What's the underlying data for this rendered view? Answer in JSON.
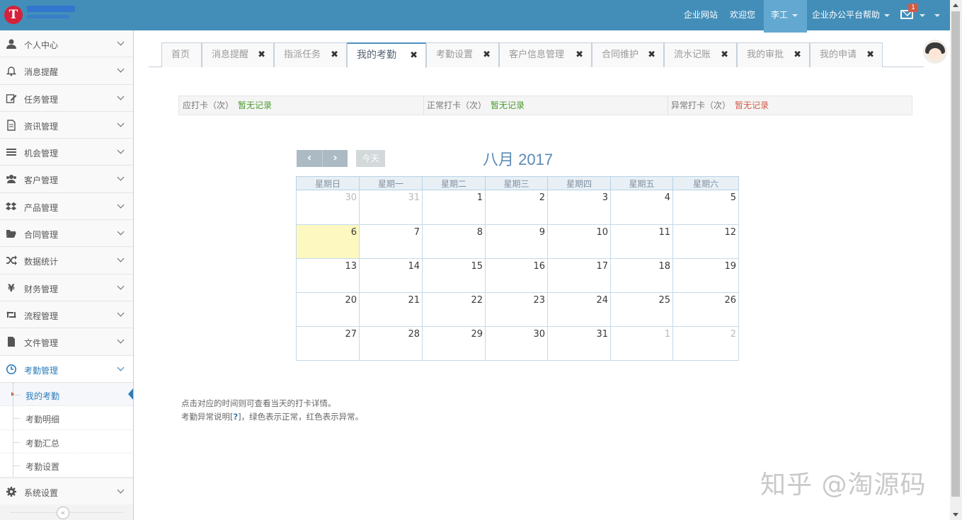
{
  "header": {
    "logo_letter": "T",
    "links": [
      "企业网站",
      "欢迎您"
    ],
    "user_name": "李工",
    "help_label": "企业办公平台帮助",
    "mail_badge": "1"
  },
  "sidebar": {
    "items": [
      {
        "label": "个人中心",
        "icon": "user-icon"
      },
      {
        "label": "消息提醒",
        "icon": "bell-icon"
      },
      {
        "label": "任务管理",
        "icon": "edit-icon"
      },
      {
        "label": "资讯管理",
        "icon": "document-icon"
      },
      {
        "label": "机会管理",
        "icon": "list-icon"
      },
      {
        "label": "客户管理",
        "icon": "users-icon"
      },
      {
        "label": "产品管理",
        "icon": "dropbox-icon"
      },
      {
        "label": "合同管理",
        "icon": "folder-open-icon"
      },
      {
        "label": "数据统计",
        "icon": "random-icon"
      },
      {
        "label": "财务管理",
        "icon": "yen-icon"
      },
      {
        "label": "流程管理",
        "icon": "retweet-icon"
      },
      {
        "label": "文件管理",
        "icon": "file-icon"
      },
      {
        "label": "考勤管理",
        "icon": "clock-icon"
      }
    ],
    "submenu": [
      "我的考勤",
      "考勤明细",
      "考勤汇总",
      "考勤设置"
    ],
    "last_item": {
      "label": "系统设置",
      "icon": "gear-icon"
    },
    "collapse_label": "«"
  },
  "tabs": [
    "首页",
    "消息提醒",
    "指派任务",
    "我的考勤",
    "考勤设置",
    "客户信息管理",
    "合同维护",
    "流水记账",
    "我的审批",
    "我的申请"
  ],
  "close_glyph": "✖",
  "stats": [
    {
      "label": "应打卡（次）",
      "value": "暂无记录",
      "color": "#4a9a2e"
    },
    {
      "label": "正常打卡（次）",
      "value": "暂无记录",
      "color": "#4a9a2e"
    },
    {
      "label": "异常打卡（次）",
      "value": "暂无记录",
      "color": "#d15b47"
    }
  ],
  "calendar": {
    "title": "八月 2017",
    "prev": "‹",
    "next": "›",
    "today_label": "今天",
    "weekdays": [
      "星期日",
      "星期一",
      "星期二",
      "星期三",
      "星期四",
      "星期五",
      "星期六"
    ],
    "weeks": [
      [
        "30",
        "31",
        "1",
        "2",
        "3",
        "4",
        "5"
      ],
      [
        "6",
        "7",
        "8",
        "9",
        "10",
        "11",
        "12"
      ],
      [
        "13",
        "14",
        "15",
        "16",
        "17",
        "18",
        "19"
      ],
      [
        "20",
        "21",
        "22",
        "23",
        "24",
        "25",
        "26"
      ],
      [
        "27",
        "28",
        "29",
        "30",
        "31",
        "1",
        "2"
      ]
    ]
  },
  "notes": {
    "line1": "点击对应的时间则可查看当天的打卡详情。",
    "line2_prefix": "考勤异常说明[",
    "line2_q": "?",
    "line2_suffix": "]，绿色表示正常，红色表示异常。"
  },
  "watermark": "知乎 @淘源码"
}
